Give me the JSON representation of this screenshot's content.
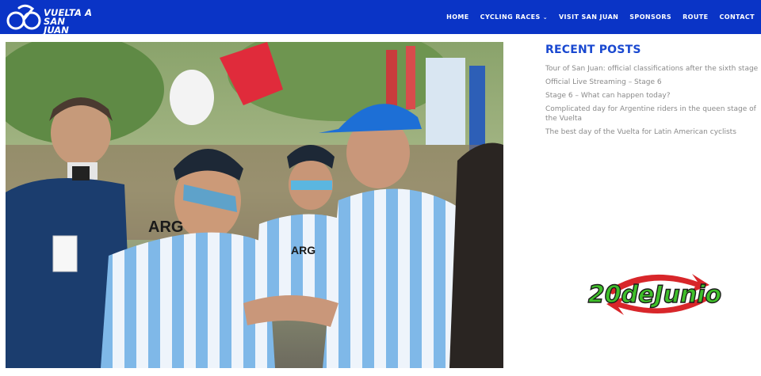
{
  "header": {
    "logo_line1": "VUELTA A",
    "logo_line2": "SAN JUAN",
    "nav": [
      {
        "label": "HOME",
        "has_dropdown": false
      },
      {
        "label": "CYCLING RACES",
        "has_dropdown": true
      },
      {
        "label": "VISIT SAN JUAN",
        "has_dropdown": false
      },
      {
        "label": "SPONSORS",
        "has_dropdown": false
      },
      {
        "label": "ROUTE",
        "has_dropdown": false
      },
      {
        "label": "CONTACT",
        "has_dropdown": false
      }
    ],
    "dropdown_icon": "chevron-down-icon",
    "colors": {
      "bar": "#0a34c6",
      "text": "#ffffff"
    }
  },
  "photo": {
    "jersey_text_left": "ARG",
    "jersey_text_center": "ARG"
  },
  "sidebar": {
    "title": "RECENT POSTS",
    "posts": [
      "Tour of San Juan: official classifications after the sixth stage",
      "Official Live Streaming – Stage 6",
      "Stage 6 – What can happen today?",
      "Complicated day for Argentine riders in the queen stage of the Vuelta",
      "The best day of the Vuelta for Latin American cyclists"
    ],
    "colors": {
      "title": "#1948d0",
      "link": "#8a8a8a"
    }
  },
  "ad": {
    "text": "20deJunio",
    "colors": {
      "text": "#3fbf2a",
      "outline": "#1a1a1a",
      "arrow": "#d8262a"
    }
  }
}
